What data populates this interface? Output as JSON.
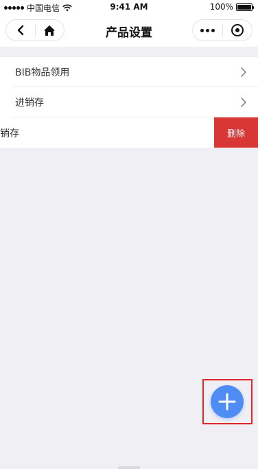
{
  "status_bar": {
    "carrier": "中国电信",
    "time": "9:41 AM",
    "battery": "100%"
  },
  "nav": {
    "title": "产品设置",
    "back_icon": "chevron-left-icon",
    "home_icon": "home-icon",
    "more_icon": "more-dots-icon",
    "close_icon": "target-circle-icon"
  },
  "list": {
    "items": [
      {
        "label": "BIB物品领用"
      },
      {
        "label": "进销存"
      }
    ],
    "swiped_item": {
      "label": "进销存",
      "delete_label": "删除"
    }
  },
  "fab": {
    "icon": "plus-icon"
  },
  "colors": {
    "accent": "#4f8df5",
    "danger": "#d93636",
    "highlight": "#e0262b",
    "background": "#f0f0f4"
  }
}
